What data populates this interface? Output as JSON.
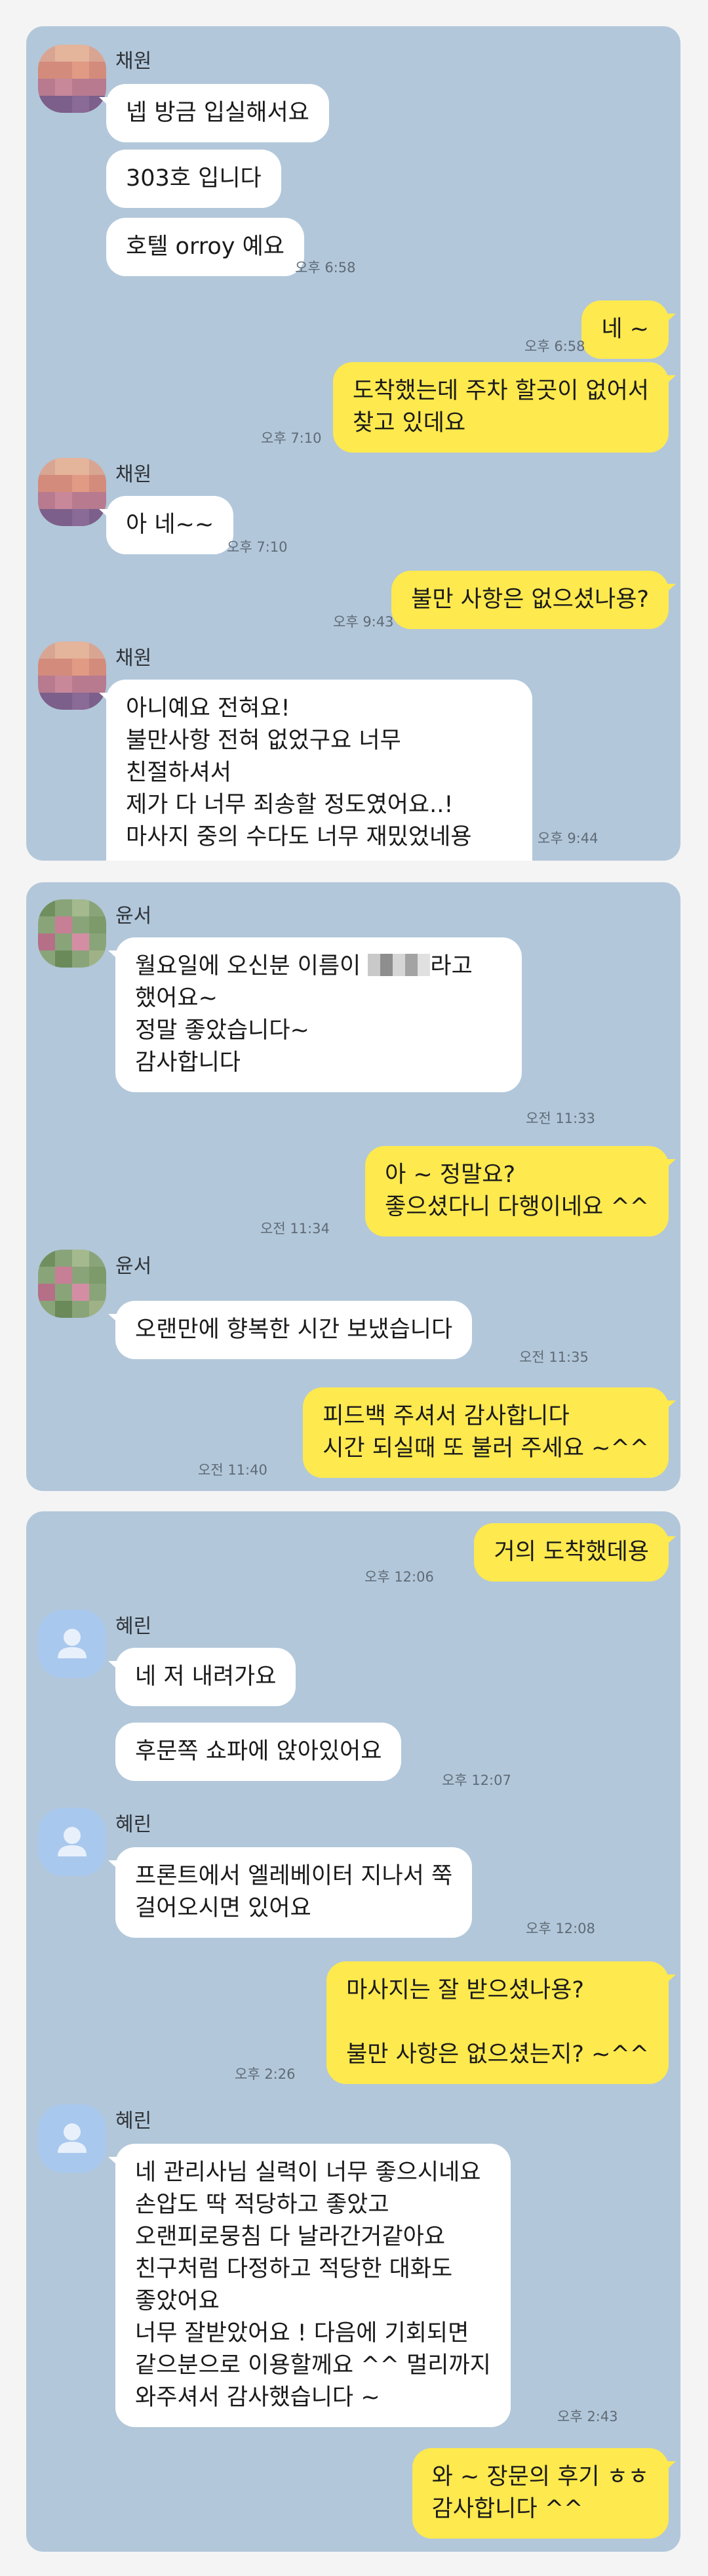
{
  "colors": {
    "chat_background": "#b2c7da",
    "outgoing_bubble": "#fee94e",
    "incoming_bubble": "#ffffff",
    "timestamp_text": "#5f6b76"
  },
  "avatar_icons": {
    "chaewon": "pixelated-profile-photo",
    "yunseo": "pixelated-profile-photo",
    "hyerin": "default-person-icon"
  },
  "chats": [
    {
      "messages": [
        {
          "sender": "채원",
          "text": "넵 방금 입실해서요"
        },
        {
          "text": "303호 입니다"
        },
        {
          "text": "호텔 orroy 예요",
          "time": "오후 6:58"
        },
        {
          "text": "네 ~",
          "time": "오후 6:58"
        },
        {
          "text": "도착했는데  주차 할곳이 없어서\n찾고 있데요",
          "time": "오후 7:10"
        },
        {
          "sender": "채원",
          "text": "아 네~~",
          "time": "오후 7:10"
        },
        {
          "text": "불만 사항은 없으셨나용?",
          "time": "오후 9:43"
        },
        {
          "sender": "채원",
          "text": "아니예요 전혀요!\n불만사항 전혀 없었구요 너무 친절하셔서\n제가 다 너무 죄송할 정도였어요..!\n마사지 중의 수다도 너무 재밌었네용\nㅎㅎㅎ",
          "time": "오후 9:44"
        }
      ]
    },
    {
      "messages": [
        {
          "sender": "윤서",
          "text_before": "월요일에 오신분 이름이 ",
          "text_after": "라고\n했어요~\n정말 좋았습니다~\n감사합니다",
          "time": "오전 11:33"
        },
        {
          "text": "아 ~ 정말요?\n좋으셨다니 다행이네요 ^^",
          "time": "오전 11:34"
        },
        {
          "sender": "윤서",
          "text": "오랜만에 향복한 시간 보냈습니다",
          "time": "오전 11:35"
        },
        {
          "text": "피드백 주셔서 감사합니다\n시간 되실때 또 불러 주세요 ~^^",
          "time": "오전 11:40"
        }
      ]
    },
    {
      "messages": [
        {
          "text": "거의 도착했데용",
          "time": "오후 12:06"
        },
        {
          "sender": "혜린",
          "text": "네 저 내려가요"
        },
        {
          "text": "후문쪽 쇼파에 앉아있어요",
          "time": "오후 12:07"
        },
        {
          "sender": "혜린",
          "text": "프론트에서 엘레베이터 지나서 쭉\n걸어오시면 있어요",
          "time": "오후 12:08"
        },
        {
          "text": "마사지는 잘 받으셨나용?\n\n불만 사항은 없으셨는지? ~^^",
          "time": "오후 2:26"
        },
        {
          "sender": "혜린",
          "text": "네 관리사님 실력이 너무 좋으시네요\n손압도 딱 적당하고 좋았고\n오랜피로뭉침 다 날라간거같아요\n친구처럼 다정하고 적당한 대화도\n좋았어요\n너무 잘받았어요 ! 다음에 기회되면\n같으분으로 이용할께요 ^^ 멀리까지\n와주셔서 감사했습니다 ~",
          "time": "오후 2:43"
        },
        {
          "text": "와 ~ 장문의 후기 ㅎㅎ\n감사합니다 ^^"
        }
      ]
    }
  ]
}
